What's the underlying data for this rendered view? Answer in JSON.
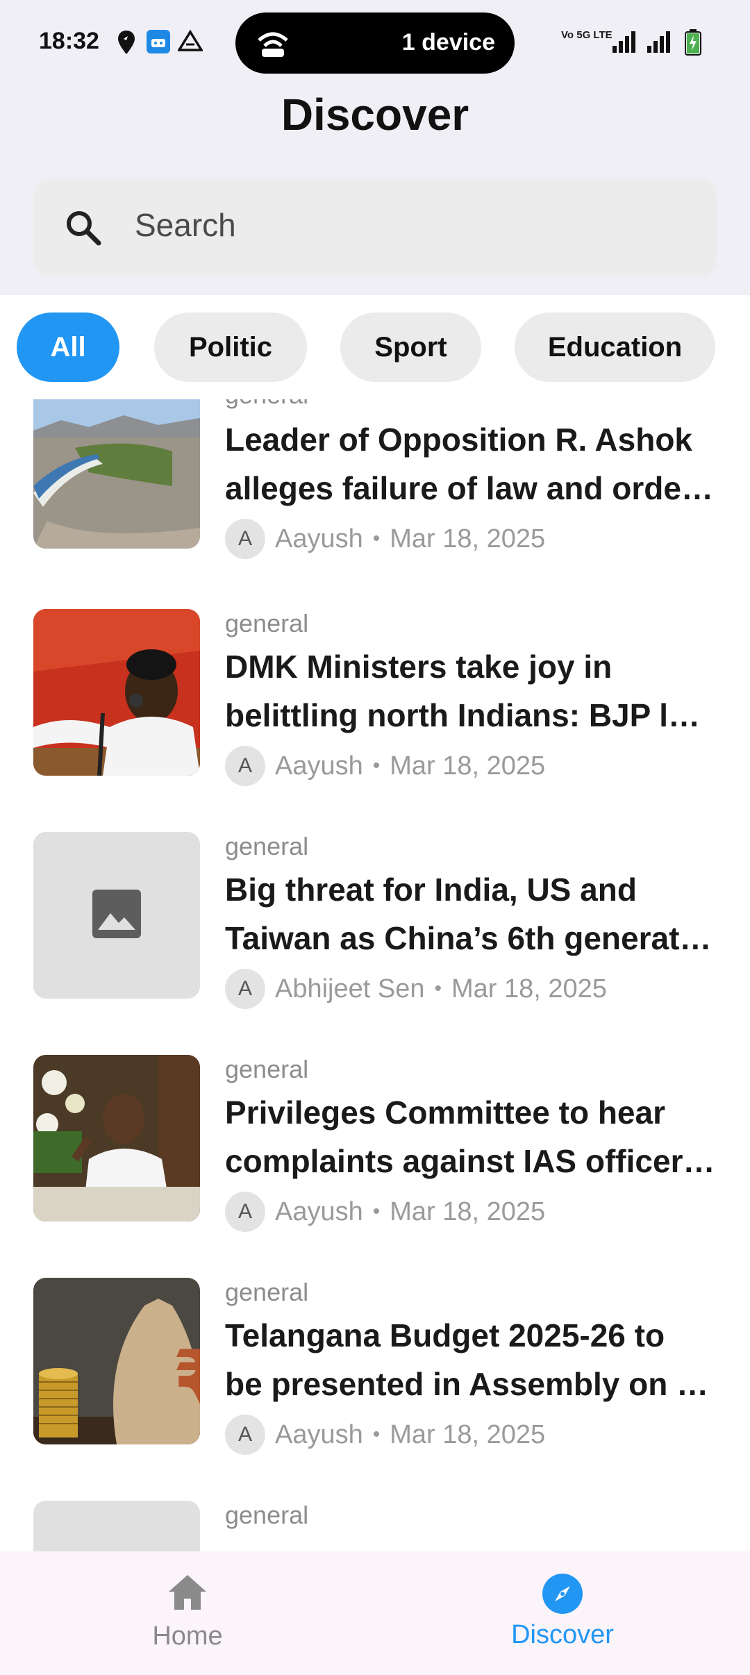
{
  "status_bar": {
    "time": "18:32",
    "pill_text": "1 device",
    "network_label": "Vo 5G LTE"
  },
  "header": {
    "title": "Discover"
  },
  "search": {
    "placeholder": "Search"
  },
  "categories": [
    {
      "label": "All",
      "active": true
    },
    {
      "label": "Politic",
      "active": false
    },
    {
      "label": "Sport",
      "active": false
    },
    {
      "label": "Education",
      "active": false
    }
  ],
  "articles": [
    {
      "category": "general",
      "title_line1": "Leader of Opposition R. Ashok",
      "title_line2": "alleges failure of law and orde…",
      "author_initial": "A",
      "author": "Aayush",
      "date": "Mar 18, 2025",
      "thumbnail": "canal-landscape-photo"
    },
    {
      "category": "general",
      "title_line1": "DMK Ministers take joy in",
      "title_line2": "belittling north Indians: BJP l…",
      "author_initial": "A",
      "author": "Aayush",
      "date": "Mar 18, 2025",
      "thumbnail": "speaker-at-podium-photo"
    },
    {
      "category": "general",
      "title_line1": "Big threat for India, US and",
      "title_line2": "Taiwan as China’s 6th generat…",
      "author_initial": "A",
      "author": "Abhijeet Sen",
      "date": "Mar 18, 2025",
      "thumbnail": "image-placeholder-icon"
    },
    {
      "category": "general",
      "title_line1": "Privileges Committee to hear",
      "title_line2": "complaints against IAS officer…",
      "author_initial": "A",
      "author": "Aayush",
      "date": "Mar 18, 2025",
      "thumbnail": "assembly-speaker-photo"
    },
    {
      "category": "general",
      "title_line1": "Telangana Budget 2025-26 to",
      "title_line2": "be presented in Assembly on …",
      "author_initial": "A",
      "author": "Aayush",
      "date": "Mar 18, 2025",
      "thumbnail": "rupee-bag-coins-photo"
    },
    {
      "category": "general",
      "thumbnail": "image-placeholder-icon"
    }
  ],
  "bottom_nav": {
    "home_label": "Home",
    "discover_label": "Discover",
    "active": "discover"
  },
  "colors": {
    "accent": "#2196f3",
    "top_background": "#f0eff5",
    "chip_background": "#ebebeb",
    "nav_background": "#fbf4fb"
  }
}
